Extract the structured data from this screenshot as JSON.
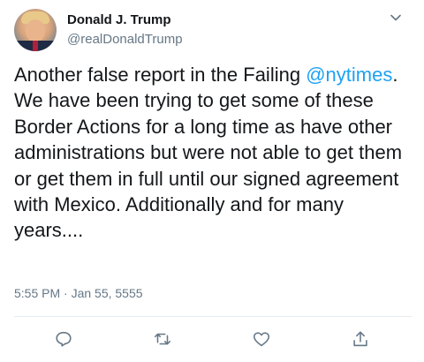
{
  "author": {
    "display_name": "Donald J. Trump",
    "handle": "@realDonaldTrump",
    "avatar_icon": "profile-photo"
  },
  "tweet": {
    "text_before": "Another false report in the Failing ",
    "mention": "@nytimes",
    "text_after": ". We have been trying to get some of these Border Actions for a long time as have other administrations but were not able to get them or get them in full until our signed agreement with Mexico. Additionally and for many years....",
    "timestamp": "5:55 PM · Jan 55, 5555"
  },
  "actions": [
    {
      "name": "reply",
      "icon": "speech-bubble-icon"
    },
    {
      "name": "retweet",
      "icon": "retweet-icon"
    },
    {
      "name": "like",
      "icon": "heart-icon"
    },
    {
      "name": "share",
      "icon": "share-icon"
    }
  ],
  "colors": {
    "text": "#14171a",
    "secondary": "#657786",
    "link": "#1da1f2",
    "divider": "#e6ecf0"
  }
}
